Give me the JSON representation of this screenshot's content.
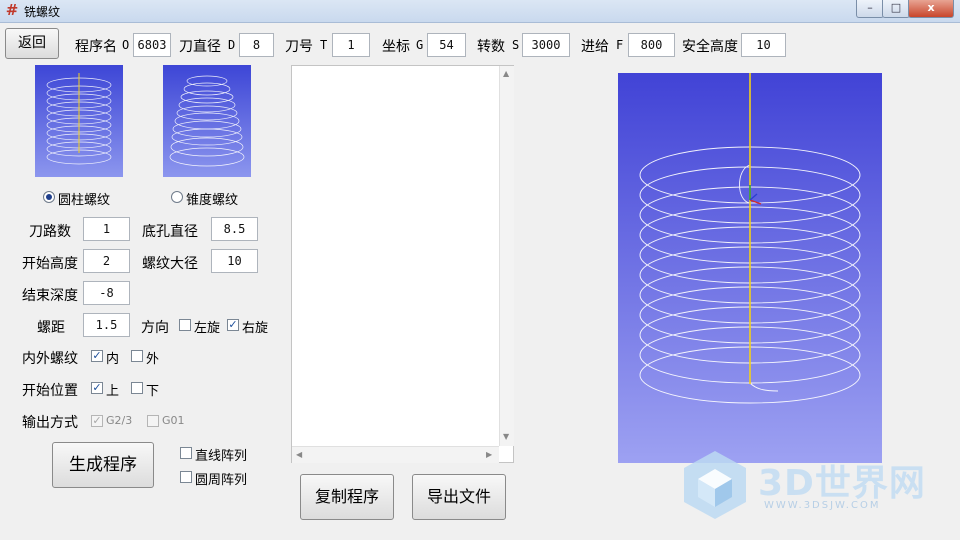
{
  "window": {
    "title": "铣螺纹",
    "min": "–",
    "max": "□",
    "close": "x"
  },
  "toolbar": {
    "back_label": "返回",
    "fields": [
      {
        "label": "程序名",
        "prefix": "O",
        "value": "6803"
      },
      {
        "label": "刀直径",
        "prefix": "D",
        "value": "8"
      },
      {
        "label": "刀号",
        "prefix": "T",
        "value": "1"
      },
      {
        "label": "坐标",
        "prefix": "G",
        "value": "54"
      },
      {
        "label": "转数",
        "prefix": "S",
        "value": "3000"
      },
      {
        "label": "进给",
        "prefix": "F",
        "value": "800"
      },
      {
        "label": "安全高度",
        "prefix": "",
        "value": "10"
      }
    ]
  },
  "thread_type": {
    "cylindrical_label": "圆柱螺纹",
    "tapered_label": "锥度螺纹",
    "selected": "cylindrical"
  },
  "params": {
    "passes_label": "刀路数",
    "passes_value": "1",
    "hole_diameter_label": "底孔直径",
    "hole_diameter_value": "8.5",
    "start_height_label": "开始高度",
    "start_height_value": "2",
    "major_diameter_label": "螺纹大径",
    "major_diameter_value": "10",
    "end_depth_label": "结束深度",
    "end_depth_value": "-8",
    "pitch_label": "螺距",
    "pitch_value": "1.5"
  },
  "direction": {
    "label": "方向",
    "left_label": "左旋",
    "left_checked": false,
    "right_label": "右旋",
    "right_checked": true
  },
  "inner_outer": {
    "label": "内外螺纹",
    "inner_label": "内",
    "inner_checked": true,
    "outer_label": "外",
    "outer_checked": false
  },
  "start_position": {
    "label": "开始位置",
    "top_label": "上",
    "top_checked": true,
    "bottom_label": "下",
    "bottom_checked": false
  },
  "output_mode": {
    "label": "输出方式",
    "g23_label": "G2/3",
    "g23_checked": true,
    "g01_label": "G01",
    "g01_checked": false
  },
  "arrays": {
    "linear_label": "直线阵列",
    "linear_checked": false,
    "circular_label": "圆周阵列",
    "circular_checked": false
  },
  "actions": {
    "generate_label": "生成程序",
    "copy_label": "复制程序",
    "export_label": "导出文件"
  },
  "watermark": {
    "brand": "3D世界网",
    "url": "WWW.3DSJW.COM"
  },
  "colors": {
    "viewport_top": "#4143d6",
    "viewport_bottom": "#9da1f2",
    "toolpath": "#ffffff",
    "axis": "#f2d01a"
  }
}
